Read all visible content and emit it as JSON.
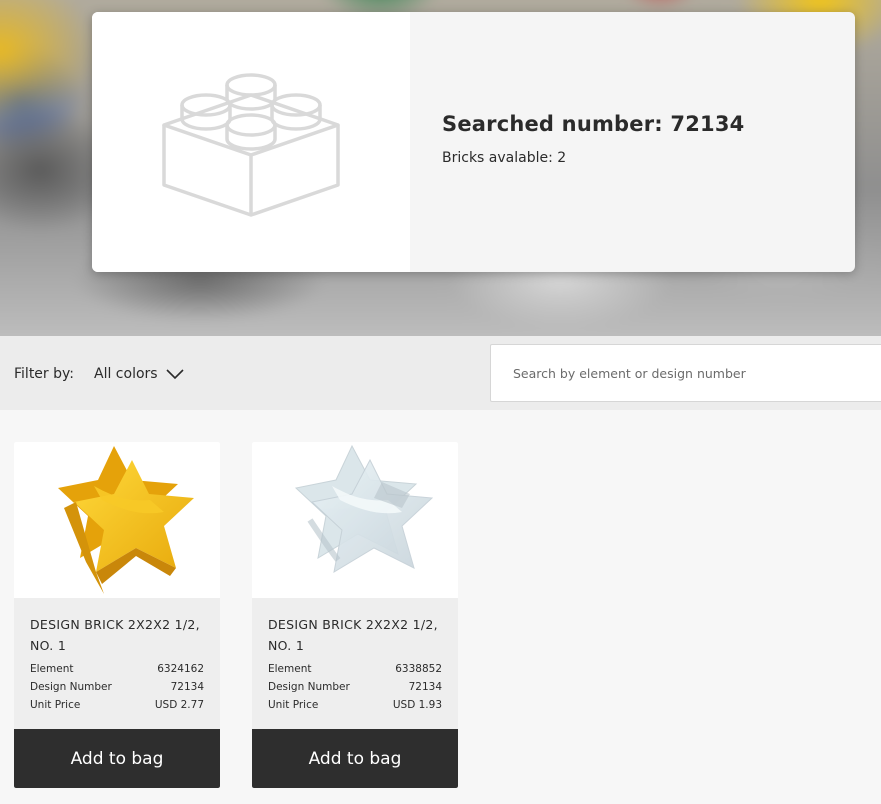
{
  "hero": {
    "title": "Searched number: 72134",
    "subtitle": "Bricks avalable: 2",
    "image_icon": "brick-placeholder-icon"
  },
  "filter": {
    "label": "Filter by:",
    "selected": "All colors",
    "chevron_icon": "chevron-down-icon"
  },
  "search": {
    "placeholder": "Search by element or design number",
    "value": ""
  },
  "products": [
    {
      "name": "DESIGN BRICK 2X2X2 1/2, NO. 1",
      "element_label": "Element",
      "element": "6324162",
      "design_label": "Design Number",
      "design": "72134",
      "price_label": "Unit Price",
      "price": "USD 2.77",
      "button": "Add to bag",
      "color": "#f2c21a"
    },
    {
      "name": "DESIGN BRICK 2X2X2 1/2, NO. 1",
      "element_label": "Element",
      "element": "6338852",
      "design_label": "Design Number",
      "design": "72134",
      "price_label": "Unit Price",
      "price": "USD 1.93",
      "button": "Add to bag",
      "color": "#dfe9ee"
    }
  ]
}
